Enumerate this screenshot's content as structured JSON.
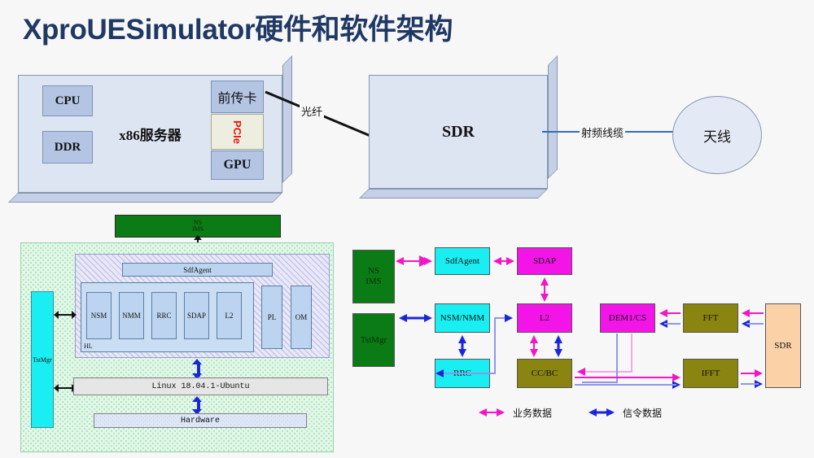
{
  "page": {
    "title": "XproUESimulator硬件和软件架构",
    "title_color": "#1f3864",
    "background": "#f7f7f7"
  },
  "hardware_diagram": {
    "server": {
      "label": "x86服务器",
      "components": [
        {
          "id": "cpu",
          "label": "CPU"
        },
        {
          "id": "ddr",
          "label": "DDR"
        },
        {
          "id": "fronthaul",
          "label": "前传卡"
        },
        {
          "id": "pcie",
          "label": "PCIe",
          "color": "#e8140c"
        },
        {
          "id": "gpu",
          "label": "GPU"
        }
      ]
    },
    "sdr": {
      "label": "SDR"
    },
    "antenna": {
      "label": "天线"
    },
    "links": [
      {
        "id": "fiber",
        "label": "光纤",
        "color": "#000000"
      },
      {
        "id": "rf-cable",
        "label": "射频线缆",
        "color": "#2f6fb5"
      }
    ]
  },
  "software_stack": {
    "external": {
      "label_line1": "NS",
      "label_line2": "IMS",
      "color": "#0b7c15"
    },
    "test_manager": {
      "label": "TstMgr",
      "color": "#19eff2"
    },
    "sdf_agent": {
      "label": "SdfAgent"
    },
    "hl_label": "HL",
    "hl_modules": [
      {
        "label": "NSM"
      },
      {
        "label": "NMM"
      },
      {
        "label": "RRC"
      },
      {
        "label": "SDAP"
      },
      {
        "label": "L2"
      }
    ],
    "side_modules": [
      {
        "label": "PL"
      },
      {
        "label": "OM"
      }
    ],
    "os": {
      "label": "Linux 18.04.1-Ubuntu"
    },
    "hardware": {
      "label": "Hardware"
    }
  },
  "block_diagram": {
    "blocks": [
      {
        "id": "ns-ims",
        "label_line1": "NS",
        "label_line2": "IMS",
        "color": "#0b7c15"
      },
      {
        "id": "tstmgr",
        "label_line1": "TstMgr",
        "label_line2": "",
        "color": "#0b7c15"
      },
      {
        "id": "sdfagent",
        "label_line1": "SdfAgent",
        "label_line2": "",
        "color": "#19eff2"
      },
      {
        "id": "sdap",
        "label_line1": "SDAP",
        "label_line2": "",
        "color": "#f315e8"
      },
      {
        "id": "nsm-nmm",
        "label_line1": "NSM/NMM",
        "label_line2": "",
        "color": "#19eff2"
      },
      {
        "id": "l2",
        "label_line1": "L2",
        "label_line2": "",
        "color": "#f315e8"
      },
      {
        "id": "rrc",
        "label_line1": "RRC",
        "label_line2": "",
        "color": "#19eff2"
      },
      {
        "id": "cc-bc",
        "label_line1": "CC/BC",
        "label_line2": "",
        "color": "#8a8410"
      },
      {
        "id": "dem1-cs",
        "label_line1": "DEM1/CS",
        "label_line2": "",
        "color": "#f315e8"
      },
      {
        "id": "fft",
        "label_line1": "FFT",
        "label_line2": "",
        "color": "#8a8410"
      },
      {
        "id": "ifft",
        "label_line1": "IFFT",
        "label_line2": "",
        "color": "#8a8410"
      },
      {
        "id": "sdr",
        "label_line1": "SDR",
        "label_line2": "",
        "color": "#fbd2a8"
      }
    ],
    "legend": [
      {
        "id": "service-data",
        "label": "业务数据",
        "color": "#f315c8"
      },
      {
        "id": "signaling-data",
        "label": "信令数据",
        "color": "#1b26d8"
      }
    ]
  }
}
